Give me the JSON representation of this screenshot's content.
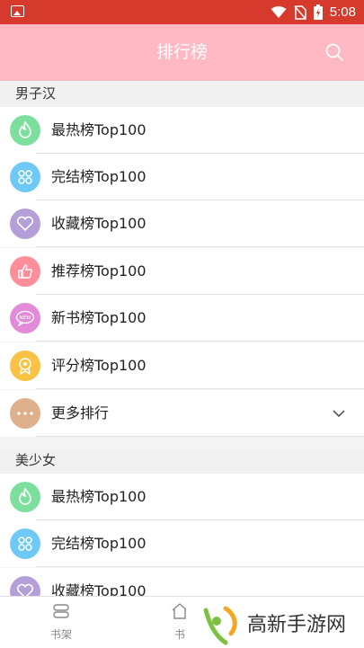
{
  "status_bar": {
    "time": "5:08"
  },
  "header": {
    "title": "排行榜"
  },
  "sections": [
    {
      "title": "男子汉",
      "items": [
        {
          "label": "最热榜Top100",
          "icon": "flame-icon",
          "color": "#7ddf9d"
        },
        {
          "label": "完结榜Top100",
          "icon": "grid-icon",
          "color": "#6ec9f7"
        },
        {
          "label": "收藏榜Top100",
          "icon": "heart-icon",
          "color": "#b59fd9"
        },
        {
          "label": "推荐榜Top100",
          "icon": "thumbs-up-icon",
          "color": "#ff8e9b"
        },
        {
          "label": "新书榜Top100",
          "icon": "new-badge-icon",
          "color": "#e38ad8"
        },
        {
          "label": "评分榜Top100",
          "icon": "medal-icon",
          "color": "#f9c242"
        },
        {
          "label": "更多排行",
          "icon": "more-icon",
          "color": "#deb08c"
        }
      ]
    },
    {
      "title": "美少女",
      "items": [
        {
          "label": "最热榜Top100",
          "icon": "flame-icon",
          "color": "#7ddf9d"
        },
        {
          "label": "完结榜Top100",
          "icon": "grid-icon",
          "color": "#6ec9f7"
        },
        {
          "label": "收藏榜Top100",
          "icon": "heart-icon",
          "color": "#b59fd9"
        }
      ]
    }
  ],
  "tab_bar": {
    "tabs": [
      "书架",
      "书"
    ]
  },
  "watermark": {
    "text": "高新手游网"
  }
}
